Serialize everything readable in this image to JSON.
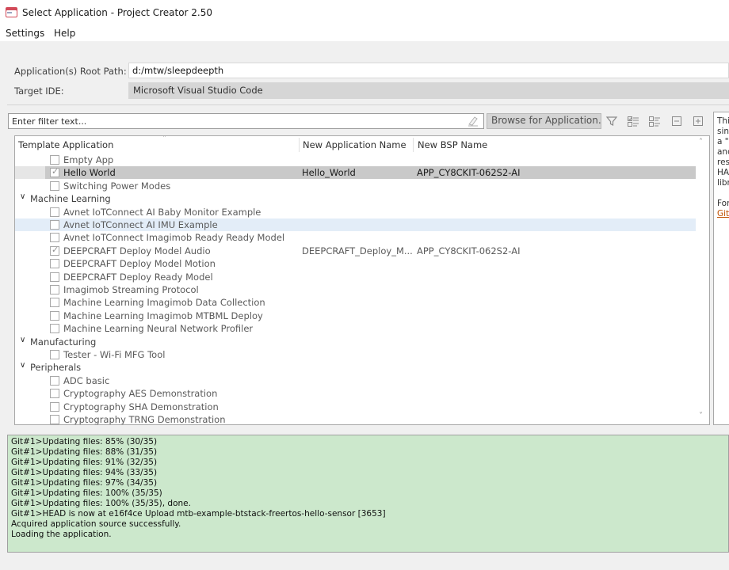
{
  "window": {
    "title": "Select Application - Project Creator 2.50"
  },
  "menu": {
    "items": [
      "Settings",
      "Help"
    ]
  },
  "form": {
    "root_path_label": "Application(s) Root Path:",
    "root_path_value": "d:/mtw/sleepdeepth",
    "target_ide_label": "Target IDE:",
    "target_ide_value": "Microsoft Visual Studio Code"
  },
  "filter": {
    "placeholder": "Enter filter text...",
    "browse_label": "Browse for Application..."
  },
  "toolbar_icons": [
    "filter-icon",
    "expand-checked-icon",
    "collapse-checked-icon",
    "collapse-all-icon",
    "expand-all-icon"
  ],
  "tree": {
    "columns": [
      "Template Application",
      "New Application Name",
      "New BSP Name"
    ],
    "rows": [
      {
        "type": "app",
        "label": "Empty App",
        "checked": false,
        "name": "",
        "bsp": ""
      },
      {
        "type": "app",
        "label": "Hello World",
        "checked": true,
        "selected": true,
        "name": "Hello_World",
        "bsp": "APP_CY8CKIT-062S2-AI"
      },
      {
        "type": "app",
        "label": "Switching Power Modes",
        "checked": false,
        "name": "",
        "bsp": ""
      },
      {
        "type": "category",
        "label": "Machine Learning"
      },
      {
        "type": "app",
        "label": "Avnet IoTConnect AI Baby Monitor Example",
        "checked": false,
        "name": "",
        "bsp": ""
      },
      {
        "type": "app",
        "label": "Avnet IoTConnect AI IMU Example",
        "checked": false,
        "hover": true,
        "name": "",
        "bsp": ""
      },
      {
        "type": "app",
        "label": "Avnet IoTConnect Imagimob Ready Ready Model",
        "checked": false,
        "name": "",
        "bsp": ""
      },
      {
        "type": "app",
        "label": "DEEPCRAFT Deploy Model Audio",
        "checked": true,
        "name": "DEEPCRAFT_Deploy_M...",
        "bsp": "APP_CY8CKIT-062S2-AI"
      },
      {
        "type": "app",
        "label": "DEEPCRAFT Deploy Model Motion",
        "checked": false,
        "name": "",
        "bsp": ""
      },
      {
        "type": "app",
        "label": "DEEPCRAFT Deploy Ready Model",
        "checked": false,
        "name": "",
        "bsp": ""
      },
      {
        "type": "app",
        "label": "Imagimob Streaming Protocol",
        "checked": false,
        "name": "",
        "bsp": ""
      },
      {
        "type": "app",
        "label": "Machine Learning Imagimob Data Collection",
        "checked": false,
        "name": "",
        "bsp": ""
      },
      {
        "type": "app",
        "label": "Machine Learning Imagimob MTBML Deploy",
        "checked": false,
        "name": "",
        "bsp": ""
      },
      {
        "type": "app",
        "label": "Machine Learning Neural Network Profiler",
        "checked": false,
        "name": "",
        "bsp": ""
      },
      {
        "type": "category",
        "label": "Manufacturing"
      },
      {
        "type": "app",
        "label": "Tester - Wi-Fi MFG Tool",
        "checked": false,
        "name": "",
        "bsp": ""
      },
      {
        "type": "category",
        "label": "Peripherals"
      },
      {
        "type": "app",
        "label": "ADC basic",
        "checked": false,
        "name": "",
        "bsp": ""
      },
      {
        "type": "app",
        "label": "Cryptography AES Demonstration",
        "checked": false,
        "name": "",
        "bsp": ""
      },
      {
        "type": "app",
        "label": "Cryptography SHA Demonstration",
        "checked": false,
        "name": "",
        "bsp": ""
      },
      {
        "type": "app",
        "label": "Cryptography TRNG Demonstration",
        "checked": false,
        "name": "",
        "bsp": ""
      }
    ]
  },
  "description": {
    "lines": [
      "Thi",
      "sin",
      "a \"",
      "and",
      "res",
      "HA",
      "libr",
      "",
      "For"
    ],
    "link": "Git"
  },
  "log": {
    "lines": [
      "Git#1>Updating files:  85% (30/35)",
      "Git#1>Updating files:  88% (31/35)",
      "Git#1>Updating files:  91% (32/35)",
      "Git#1>Updating files:  94% (33/35)",
      "Git#1>Updating files:  97% (34/35)",
      "Git#1>Updating files: 100% (35/35)",
      "Git#1>Updating files: 100% (35/35), done.",
      "Git#1>HEAD is now at e16f4ce Upload mtb-example-btstack-freertos-hello-sensor [3653]",
      "Acquired application source successfully.",
      "Loading the application."
    ]
  },
  "colors": {
    "log_background": "#cce8cc",
    "selected_row": "#c9c9c9",
    "hover_row": "#e3edf8",
    "link": "#c05000",
    "app_icon": "#d24a59"
  }
}
